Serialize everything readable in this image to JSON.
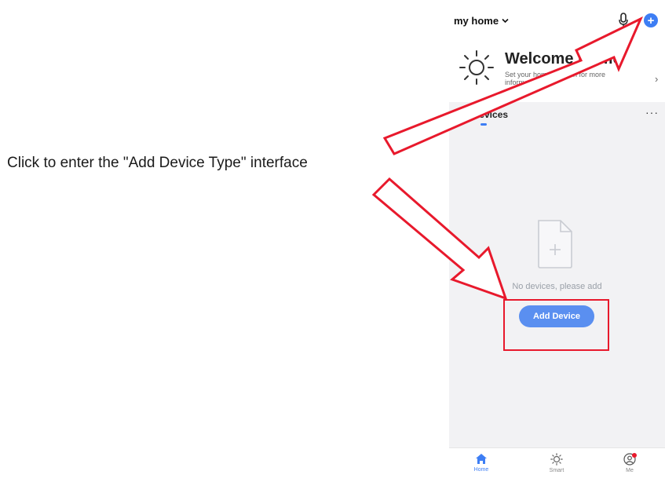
{
  "annotation": {
    "text": "Click to enter the \"Add Device Type\" interface"
  },
  "header": {
    "home_name": "my home",
    "dropdown_icon": "chevron-down-icon",
    "mic_icon": "microphone-icon",
    "add_icon": "plus-circle-icon"
  },
  "welcome": {
    "title": "Welcome Home",
    "subtitle": "Set your home location for more information",
    "icon": "sun-icon"
  },
  "devices": {
    "tab_label": "All Devices",
    "more_label": "···",
    "empty_text": "No devices, please add",
    "add_button_label": "Add Device"
  },
  "bottom_nav": {
    "items": [
      {
        "label": "Home",
        "icon": "home-icon",
        "active": true
      },
      {
        "label": "Smart",
        "icon": "sun-icon",
        "active": false
      },
      {
        "label": "Me",
        "icon": "user-icon",
        "active": false
      }
    ]
  },
  "colors": {
    "accent": "#3d7ef4",
    "button": "#5a8ff0",
    "annotation_red": "#e8192c"
  }
}
